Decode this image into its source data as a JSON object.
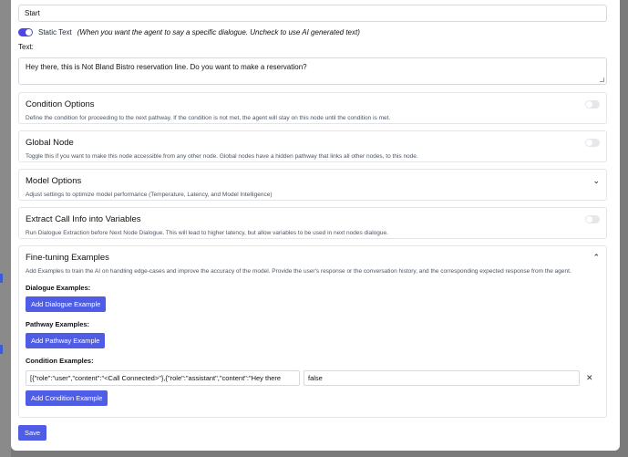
{
  "node": {
    "name_value": "Start",
    "static_text_label": "Static Text",
    "static_text_hint": "(When you want the agent to say a specific dialogue. Uncheck to use AI generated text)",
    "static_text_enabled": true,
    "text_label": "Text:",
    "text_value": "Hey there, this is Not Bland Bistro reservation line. Do you want to make a reservation?"
  },
  "sections": {
    "condition": {
      "title": "Condition Options",
      "desc": "Define the condition for proceeding to the next pathway. If the condition is not met, the agent will stay on this node until the condition is met.",
      "enabled": false
    },
    "global": {
      "title": "Global Node",
      "desc": "Toggle this if you want to make this node accessible from any other node. Global nodes have a hidden pathway that links all other nodes, to this node.",
      "enabled": false
    },
    "model": {
      "title": "Model Options",
      "desc": "Adjust settings to optimize model performance (Temperature, Latency, and Model Intelligence)"
    },
    "extract": {
      "title": "Extract Call Info into Variables",
      "desc": "Run Dialogue Extraction before Next Node Dialogue. This will lead to higher latency, but allow variables to be used in next nodes dialogue.",
      "enabled": false
    },
    "finetune": {
      "title": "Fine-tuning Examples",
      "desc": "Add Examples to train the AI on handling edge-cases and improve the accuracy of the model. Provide the user's response or the conversation history, and the corresponding expected response from the agent.",
      "dialogue_heading": "Dialogue Examples:",
      "dialogue_button": "Add Dialogue Example",
      "pathway_heading": "Pathway Examples:",
      "pathway_button": "Add Pathway Example",
      "condition_heading": "Condition Examples:",
      "condition_example_value": "[{\"role\":\"user\",\"content\":\"<Call Connected>\"},{\"role\":\"assistant\",\"content\":\"Hey there",
      "condition_example_result": "false",
      "condition_button": "Add Condition Example"
    }
  },
  "footer": {
    "save_label": "Save"
  },
  "colors": {
    "accent": "#4f5ce6",
    "toggle_on": "#4f46e5",
    "toggle_off": "#e5e7eb"
  }
}
